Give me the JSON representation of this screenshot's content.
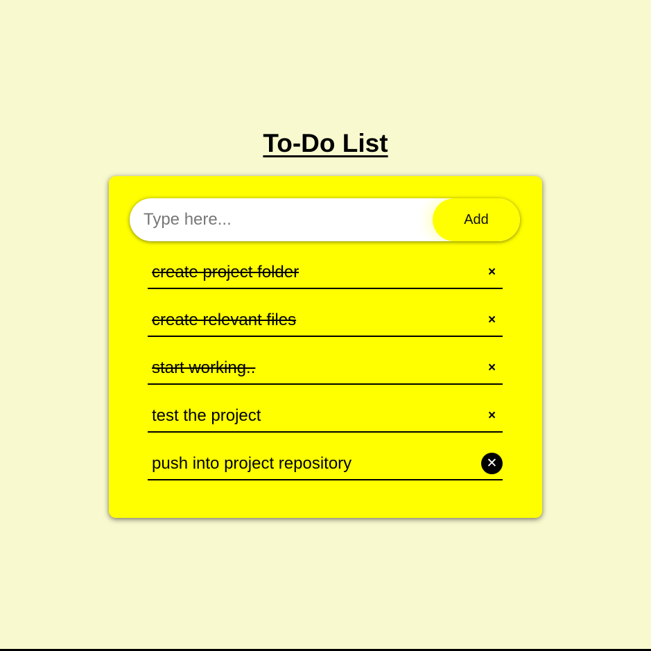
{
  "header": {
    "title": "To-Do List"
  },
  "input": {
    "placeholder": "Type here...",
    "value": "",
    "add_label": "Add"
  },
  "todos": [
    {
      "text": "create project folder",
      "checked": true,
      "close_glyph": "×"
    },
    {
      "text": "create relevant files",
      "checked": true,
      "close_glyph": "×"
    },
    {
      "text": "start working..",
      "checked": true,
      "close_glyph": "×"
    },
    {
      "text": "test the project",
      "checked": false,
      "close_glyph": "×"
    },
    {
      "text": "push into project repository",
      "checked": false,
      "close_glyph": "✕",
      "hovered": true
    }
  ],
  "colors": {
    "page_background": "#f9f9cf",
    "card_background": "#ffff00",
    "accent": "#ffff00",
    "text": "#000000"
  },
  "icons": {
    "close": "close-icon"
  }
}
